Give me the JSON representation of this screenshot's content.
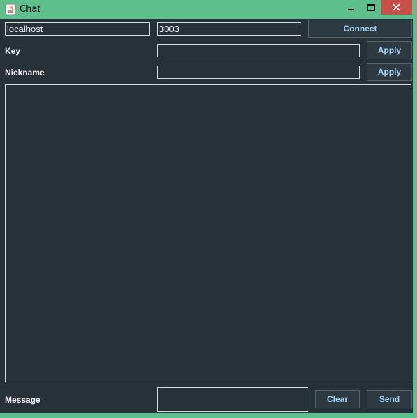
{
  "window": {
    "title": "Chat"
  },
  "connection": {
    "host": "localhost",
    "port": "3003",
    "connect_label": "Connect"
  },
  "key": {
    "label": "Key",
    "value": "",
    "apply_label": "Apply"
  },
  "nickname": {
    "label": "Nickname",
    "value": "",
    "apply_label": "Apply"
  },
  "chat_log": {
    "text": ""
  },
  "message": {
    "label": "Message",
    "value": "",
    "clear_label": "Clear",
    "send_label": "Send"
  },
  "colors": {
    "background": "#263238",
    "accent": "#a9d4f5",
    "titlebar": "#5cbf8c",
    "close": "#c7504b"
  }
}
